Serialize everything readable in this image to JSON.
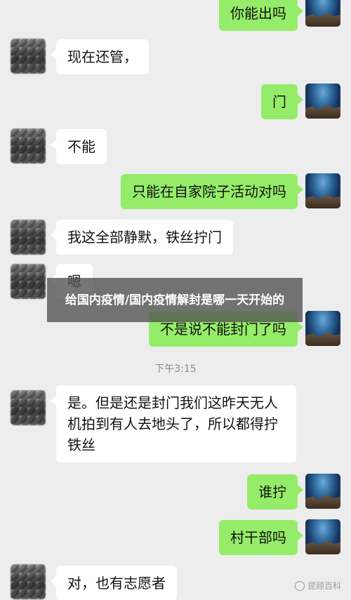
{
  "messages": [
    {
      "side": "out",
      "text": "你能出吗"
    },
    {
      "side": "in",
      "text": "现在还管，"
    },
    {
      "side": "out",
      "text": "门"
    },
    {
      "side": "in",
      "text": "不能"
    },
    {
      "side": "out",
      "text": "只能在自家院子活动对吗"
    },
    {
      "side": "in",
      "text": "我这全部静默，铁丝拧门"
    },
    {
      "side": "in",
      "text": "嗯"
    },
    {
      "side": "out",
      "text": "不是说不能封门了吗"
    },
    {
      "side": "in",
      "text": "是。但是还是封门我们这昨天无人\n机拍到有人去地头了，所以都得拧\n铁丝"
    },
    {
      "side": "out",
      "text": "谁拧"
    },
    {
      "side": "out",
      "text": "村干部吗"
    },
    {
      "side": "in",
      "text": "对，也有志愿者"
    }
  ],
  "timestamp": "下午3:15",
  "overlay_title": "给国内疫情/国内疫情解封是哪一天开始的",
  "watermark": "昆顾百科",
  "colors": {
    "background": "#ededed",
    "bubble_out": "#95ec69",
    "bubble_in": "#ffffff"
  }
}
